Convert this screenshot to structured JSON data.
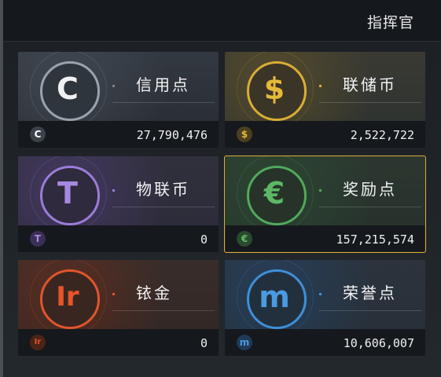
{
  "header": {
    "title": "指挥官"
  },
  "currencies": [
    {
      "name": "信用点",
      "amount": "27,790,476",
      "icon": "credit-c-icon",
      "glyph": "C",
      "accent": "#9aa3ad",
      "tint": "#5d6670"
    },
    {
      "name": "联储币",
      "amount": "2,522,722",
      "icon": "dollar-icon",
      "glyph": "$",
      "accent": "#d9ad36",
      "tint": "#7a6224"
    },
    {
      "name": "物联币",
      "amount": "0",
      "icon": "iot-coin-icon",
      "glyph": "T",
      "accent": "#9b7cd8",
      "tint": "#5a4188"
    },
    {
      "name": "奖励点",
      "amount": "157,215,574",
      "icon": "reward-e-icon",
      "glyph": "€",
      "accent": "#52a85c",
      "tint": "#2c5b34"
    },
    {
      "name": "铱金",
      "amount": "0",
      "icon": "iridium-ir-icon",
      "glyph": "Ir",
      "accent": "#e0552c",
      "tint": "#7d2e18"
    },
    {
      "name": "荣誉点",
      "amount": "10,606,007",
      "icon": "honor-m-icon",
      "glyph": "m",
      "accent": "#3f8fd6",
      "tint": "#1f4b78"
    }
  ]
}
